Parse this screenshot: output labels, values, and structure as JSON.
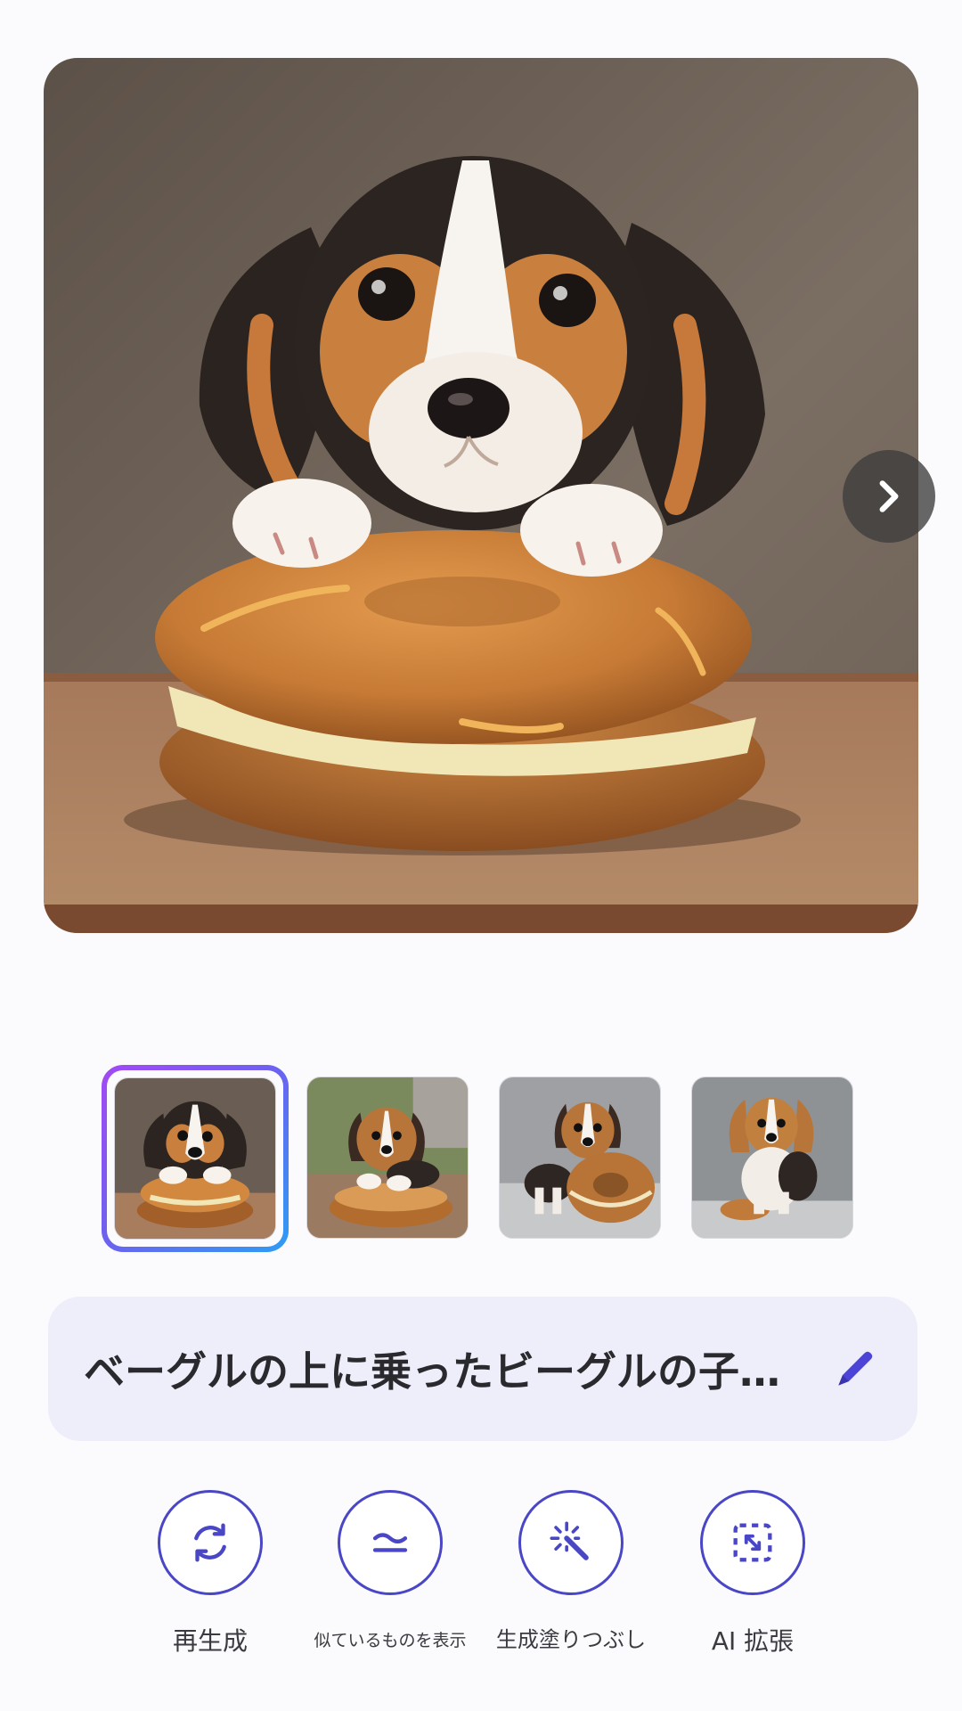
{
  "main_image": {
    "description": "beagle-puppy-on-bagel"
  },
  "thumbnails": [
    {
      "selected": true
    },
    {
      "selected": false
    },
    {
      "selected": false
    },
    {
      "selected": false
    }
  ],
  "prompt": {
    "text": "ベーグルの上に乗ったビーグルの子…"
  },
  "actions": [
    {
      "label": "再生成",
      "icon": "regenerate-icon"
    },
    {
      "label": "似ているものを表示",
      "icon": "similar-icon"
    },
    {
      "label": "生成塗りつぶし",
      "icon": "magic-wand-icon"
    },
    {
      "label": "AI 拡張",
      "icon": "expand-icon"
    }
  ],
  "colors": {
    "accent": "#4a47c7",
    "prompt_bg": "#eeeefa",
    "gradient_start": "#a349f4",
    "gradient_end": "#2d9df5"
  }
}
